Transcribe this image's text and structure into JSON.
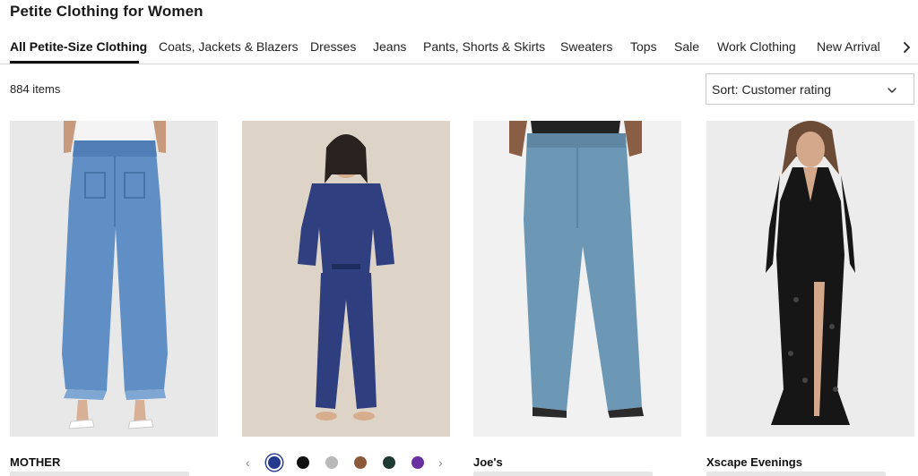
{
  "page": {
    "title": "Petite Clothing for Women"
  },
  "tabs": [
    {
      "label": "All Petite-Size Clothing",
      "active": true
    },
    {
      "label": "Coats, Jackets & Blazers"
    },
    {
      "label": "Dresses"
    },
    {
      "label": "Jeans"
    },
    {
      "label": "Pants, Shorts & Skirts"
    },
    {
      "label": "Sweaters"
    },
    {
      "label": "Tops"
    },
    {
      "label": "Sale"
    },
    {
      "label": "Work Clothing"
    },
    {
      "label": "New Arrival"
    }
  ],
  "results": {
    "count_label": "884 items"
  },
  "sort": {
    "label": "Sort: Customer rating"
  },
  "products": [
    {
      "brand": "MOTHER"
    },
    {
      "brand": ""
    },
    {
      "brand": "Joe's"
    },
    {
      "brand": "Xscape Evenings"
    }
  ],
  "swatches": {
    "colors": [
      "#243a8c",
      "#111111",
      "#b9b9b9",
      "#8a5a3a",
      "#1f3a33",
      "#6a2fa1"
    ],
    "selected_index": 0
  },
  "icons": {
    "tabs_next": "chevron-right-icon",
    "sort": "chevron-down-icon",
    "swatch_prev": "chevron-left-icon",
    "swatch_next": "chevron-right-icon"
  }
}
